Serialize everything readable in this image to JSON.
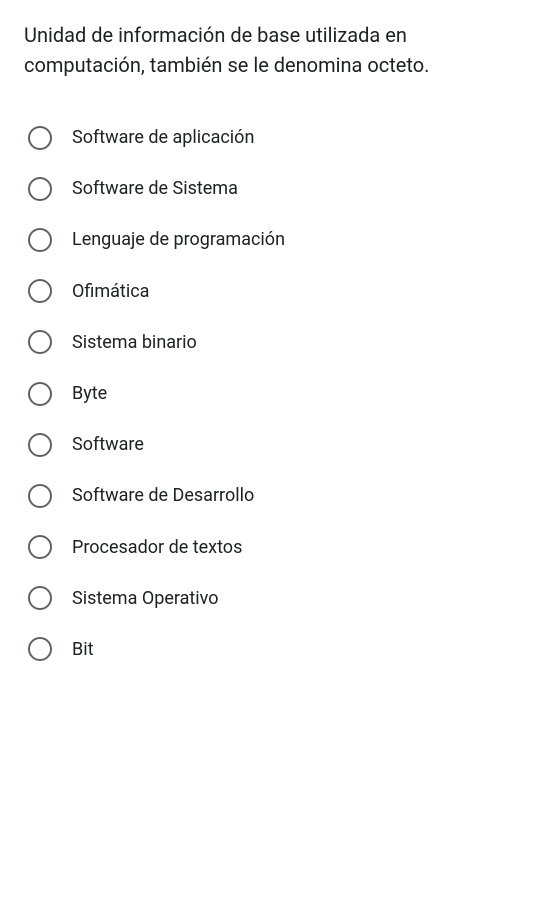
{
  "question": "Unidad de información de base utilizada en computación, también se le denomina octeto.",
  "options": [
    {
      "label": "Software de aplicación"
    },
    {
      "label": "Software de Sistema"
    },
    {
      "label": "Lenguaje de programación"
    },
    {
      "label": "Ofimática"
    },
    {
      "label": "Sistema binario"
    },
    {
      "label": "Byte"
    },
    {
      "label": "Software"
    },
    {
      "label": "Software de Desarrollo"
    },
    {
      "label": "Procesador de textos"
    },
    {
      "label": "Sistema Operativo"
    },
    {
      "label": "Bit"
    }
  ]
}
